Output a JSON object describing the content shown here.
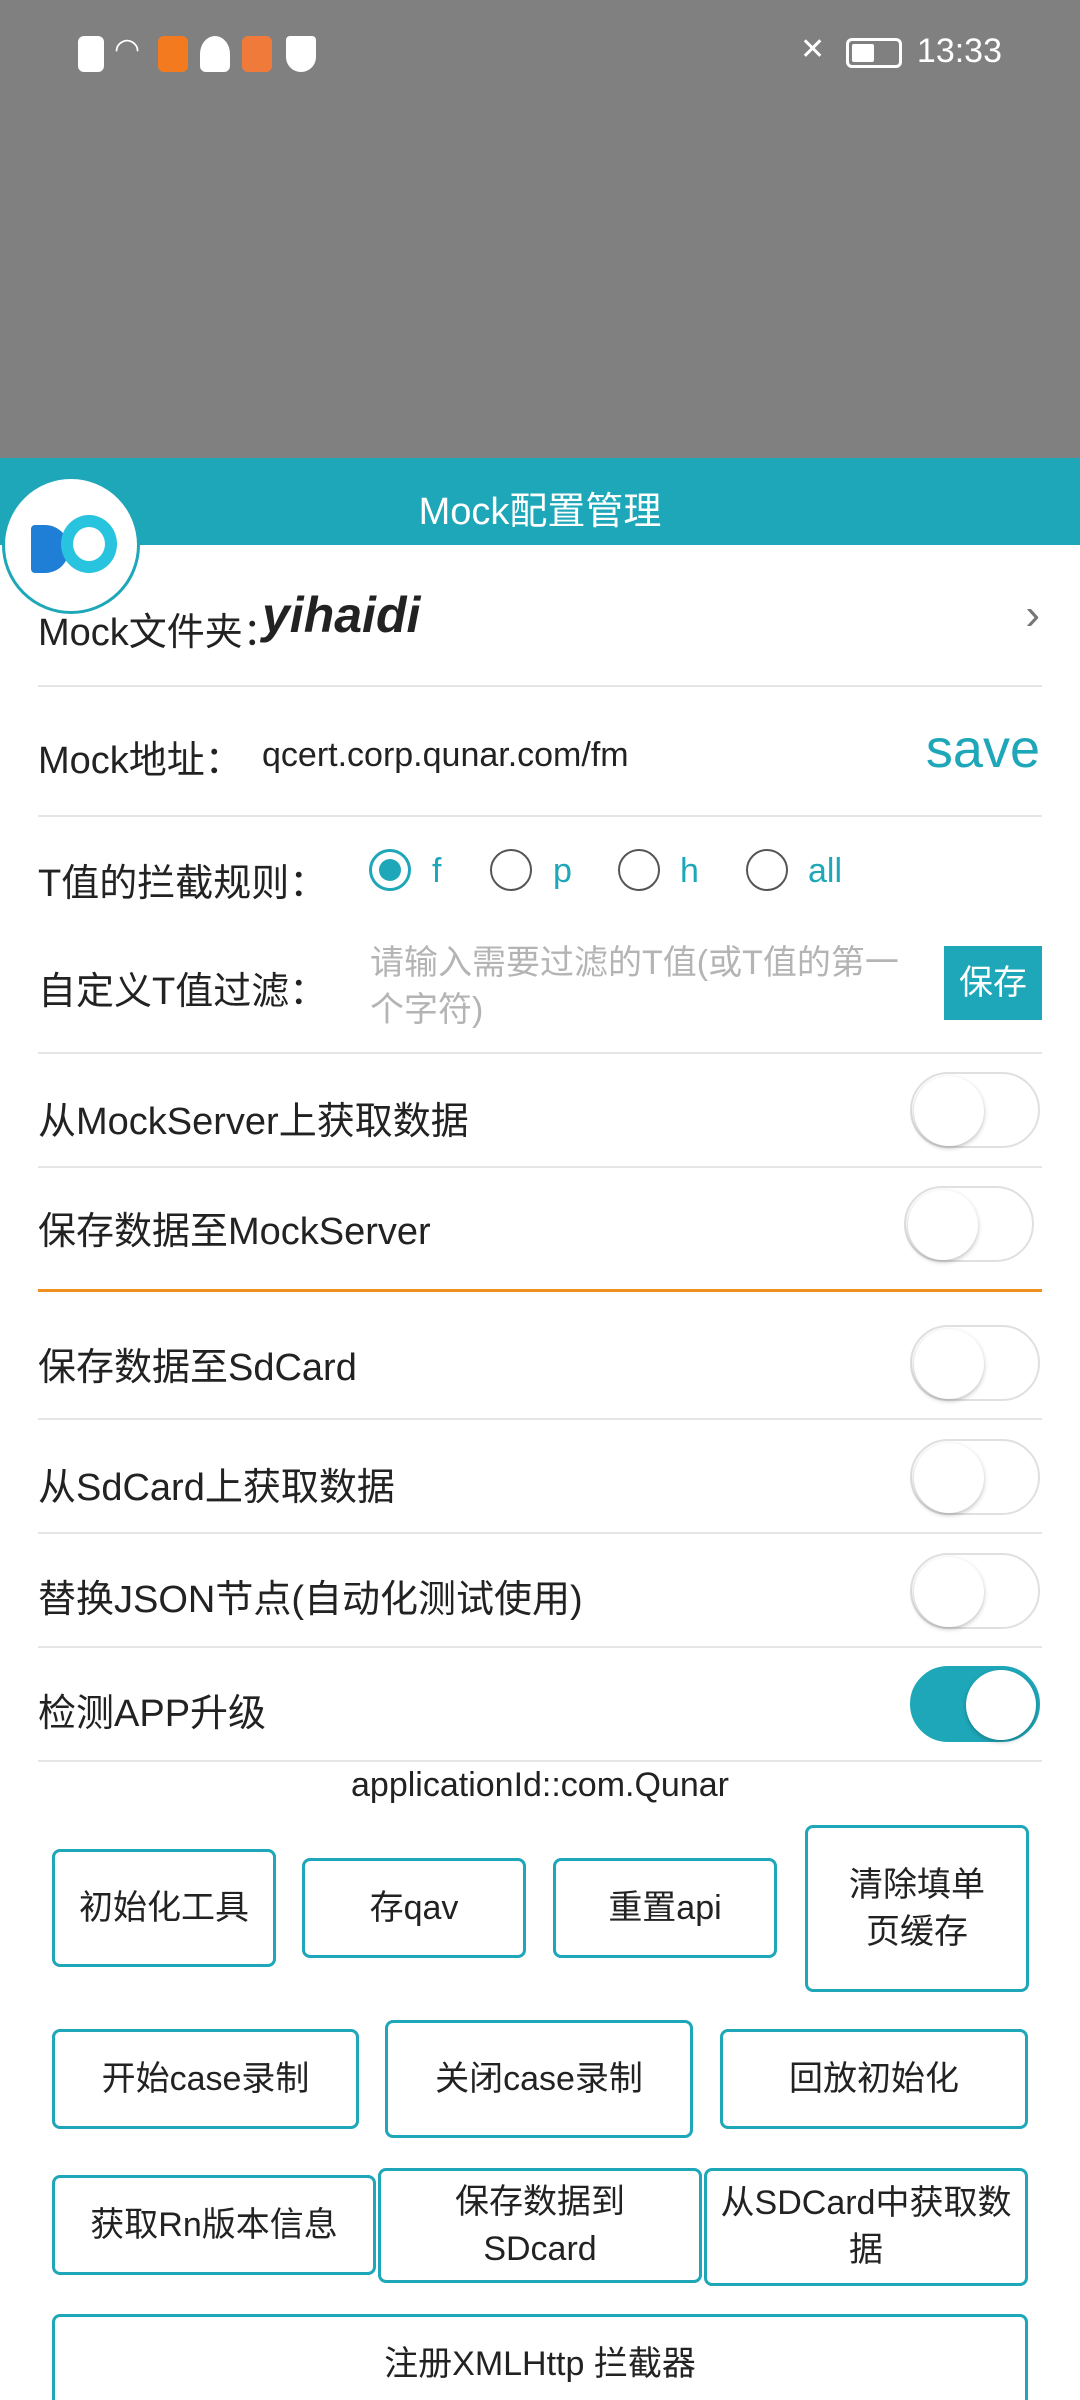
{
  "status_bar": {
    "time": "13:33",
    "left_icons": [
      "alert-icon",
      "wifi-icon",
      "uc-browser-icon",
      "qq-icon",
      "app-icon",
      "shield-icon"
    ],
    "right_icons": [
      "mute-icon",
      "battery-icon"
    ]
  },
  "header": {
    "title": "Mock配置管理"
  },
  "mock_folder": {
    "label": "Mock文件夹：",
    "value": "yihaidi"
  },
  "mock_address": {
    "label": "Mock地址：",
    "value": "qcert.corp.qunar.com/fm",
    "save_label": "save"
  },
  "t_rule": {
    "label": "T值的拦截规则：",
    "options": [
      "f",
      "p",
      "h",
      "all"
    ],
    "selected": "f"
  },
  "t_filter": {
    "label": "自定义T值过滤：",
    "placeholder": "请输入需要过滤的T值(或T值的第一个字符)",
    "save_label": "保存"
  },
  "toggles": [
    {
      "label": "从MockServer上获取数据",
      "on": false
    },
    {
      "label": "保存数据至MockServer",
      "on": false
    },
    {
      "label": "保存数据至SdCard",
      "on": false
    },
    {
      "label": "从SdCard上获取数据",
      "on": false
    },
    {
      "label": "替换JSON节点(自动化测试使用)",
      "on": false
    },
    {
      "label": "检测APP升级",
      "on": true
    }
  ],
  "application_id": "applicationId::com.Qunar",
  "buttons": {
    "init_tool": "初始化工具",
    "save_qav": "存qav",
    "reset_api": "重置api",
    "clear_form_cache": "清除填单页缓存",
    "start_case_record": "开始case录制",
    "stop_case_record": "关闭case录制",
    "replay_init": "回放初始化",
    "get_rn_version": "获取Rn版本信息",
    "save_to_sdcard": "保存数据到SDcard",
    "get_from_sdcard": "从SDCard中获取数据",
    "register_xmlhttp": "注册XMLHttp 拦截器"
  },
  "colors": {
    "accent": "#1ea7b8",
    "divider_highlight": "#f09020",
    "dim_overlay": "#808080"
  }
}
